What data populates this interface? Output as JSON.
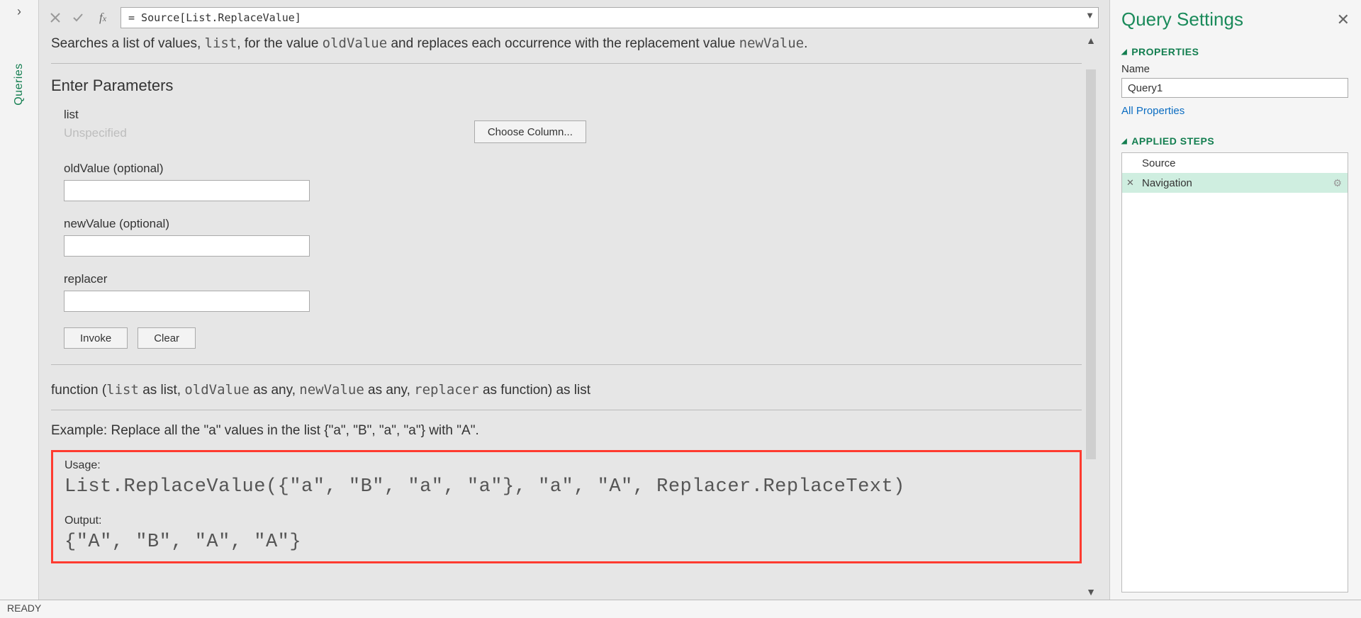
{
  "queries": {
    "label": "Queries"
  },
  "formulaBar": {
    "value": "= Source[List.ReplaceValue]"
  },
  "description": {
    "pre": "Searches a list of values, ",
    "c1": "list",
    "mid1": ", for the value ",
    "c2": "oldValue",
    "mid2": " and replaces each occurrence with the replacement value ",
    "c3": "newValue",
    "post": "."
  },
  "params": {
    "title": "Enter Parameters",
    "list_label": "list",
    "list_unspecified": "Unspecified",
    "choose_label": "Choose Column...",
    "old_label": "oldValue (optional)",
    "new_label": "newValue (optional)",
    "replacer_label": "replacer",
    "invoke": "Invoke",
    "clear": "Clear"
  },
  "signature": {
    "pre": "function (",
    "c1": "list",
    "m1": " as list, ",
    "c2": "oldValue",
    "m2": " as any, ",
    "c3": "newValue",
    "m3": " as any, ",
    "c4": "replacer",
    "post": " as function) as list"
  },
  "example": {
    "title": "Example: Replace all the \"a\" values in the list {\"a\", \"B\", \"a\", \"a\"} with \"A\".",
    "usage_label": "Usage:",
    "usage_code": "List.ReplaceValue({\"a\", \"B\", \"a\", \"a\"}, \"a\", \"A\", Replacer.ReplaceText)",
    "output_label": "Output:",
    "output_code": "{\"A\", \"B\", \"A\", \"A\"}"
  },
  "settings": {
    "title": "Query Settings",
    "properties": "PROPERTIES",
    "name_label": "Name",
    "name_value": "Query1",
    "all_props": "All Properties",
    "applied": "APPLIED STEPS",
    "steps": {
      "s0": "Source",
      "s1": "Navigation"
    }
  },
  "status": {
    "text": "READY"
  }
}
